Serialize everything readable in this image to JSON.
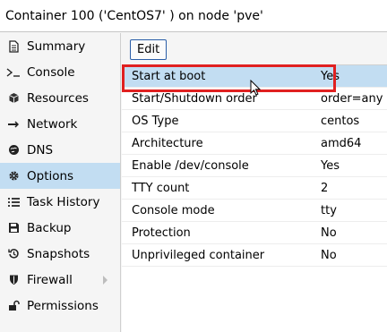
{
  "header": {
    "title": "Container 100 ('CentOS7' ) on node 'pve'"
  },
  "sidebar": {
    "items": [
      {
        "label": "Summary",
        "icon": "summary-icon"
      },
      {
        "label": "Console",
        "icon": "console-icon"
      },
      {
        "label": "Resources",
        "icon": "resources-icon"
      },
      {
        "label": "Network",
        "icon": "network-icon"
      },
      {
        "label": "DNS",
        "icon": "dns-icon"
      },
      {
        "label": "Options",
        "icon": "gear-icon",
        "selected": true
      },
      {
        "label": "Task History",
        "icon": "list-icon"
      },
      {
        "label": "Backup",
        "icon": "floppy-icon"
      },
      {
        "label": "Snapshots",
        "icon": "history-icon"
      },
      {
        "label": "Firewall",
        "icon": "shield-icon",
        "has_submenu": true
      },
      {
        "label": "Permissions",
        "icon": "unlock-icon"
      }
    ]
  },
  "toolbar": {
    "edit_label": "Edit"
  },
  "options": {
    "rows": [
      {
        "name": "Start at boot",
        "value": "Yes",
        "selected": true
      },
      {
        "name": "Start/Shutdown order",
        "value": "order=any"
      },
      {
        "name": "OS Type",
        "value": "centos"
      },
      {
        "name": "Architecture",
        "value": "amd64"
      },
      {
        "name": "Enable /dev/console",
        "value": "Yes"
      },
      {
        "name": "TTY count",
        "value": "2"
      },
      {
        "name": "Console mode",
        "value": "tty"
      },
      {
        "name": "Protection",
        "value": "No"
      },
      {
        "name": "Unprivileged container",
        "value": "No"
      }
    ]
  },
  "colors": {
    "selection": "#c2ddf2",
    "highlight_box": "#e02020",
    "button_border": "#2a5ea8"
  }
}
